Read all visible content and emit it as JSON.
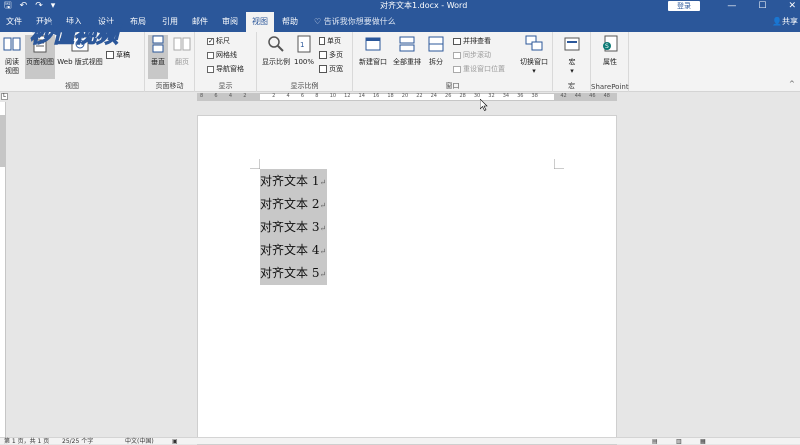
{
  "titlebar": {
    "doc_title": "对齐文本1.docx - Word",
    "login_label": "登录",
    "minimize": "—",
    "maximize": "☐",
    "close": "✕"
  },
  "tabs": {
    "file": "文件",
    "home": "开始",
    "insert": "插入",
    "design": "设计",
    "layout": "布局",
    "references": "引用",
    "mailings": "邮件",
    "review": "审阅",
    "view": "视图",
    "help": "帮助",
    "tell_me": "告诉我你想要做什么",
    "share": "共享"
  },
  "watermark": {
    "text": "秒懂视频"
  },
  "ribbon": {
    "views": {
      "read_mode": "阅读\n视图",
      "print_layout": "页面视图",
      "web_layout": "Web 版式视图",
      "draft": "草稿",
      "group_label": "视图"
    },
    "page_movement": {
      "vertical": "垂直",
      "side_by_side": "翻页",
      "group_label": "页面移动"
    },
    "show": {
      "ruler": "标尺",
      "gridlines": "网格线",
      "nav_pane": "导航窗格",
      "ruler_checked": true,
      "gridlines_checked": false,
      "nav_pane_checked": false,
      "group_label": "显示"
    },
    "zoom": {
      "zoom": "显示比例",
      "zoom_100": "100%",
      "one_page": "单页",
      "multiple_pages": "多页",
      "page_width": "页宽",
      "group_label": "显示比例"
    },
    "window": {
      "new_window": "新建窗口",
      "arrange_all": "全部重排",
      "split": "拆分",
      "view_side_by_side": "并排查看",
      "sync_scroll": "同步滚动",
      "reset_position": "重设窗口位置",
      "switch_windows": "切换窗口",
      "group_label": "窗口"
    },
    "macros": {
      "macros": "宏",
      "group_label": "宏"
    },
    "sharepoint": {
      "properties": "属性",
      "group_label": "SharePoint"
    }
  },
  "ruler": {
    "numbers": [
      "8",
      "6",
      "4",
      "2",
      "",
      "2",
      "4",
      "6",
      "8",
      "10",
      "12",
      "14",
      "16",
      "18",
      "20",
      "22",
      "24",
      "26",
      "28",
      "30",
      "32",
      "34",
      "36",
      "38",
      "",
      "42",
      "44",
      "46",
      "48"
    ]
  },
  "document": {
    "lines": [
      "对齐文本 1",
      "对齐文本 2",
      "对齐文本 3",
      "对齐文本 4",
      "对齐文本 5"
    ],
    "paragraph_mark": "↵"
  },
  "statusbar": {
    "page": "第 1 页，共 1 页",
    "words": "25/25 个字",
    "language": "中文(中国)"
  },
  "colors": {
    "accent": "#2b579a",
    "ribbon_bg": "#f3f3f3",
    "selection": "#c8c8c8"
  }
}
